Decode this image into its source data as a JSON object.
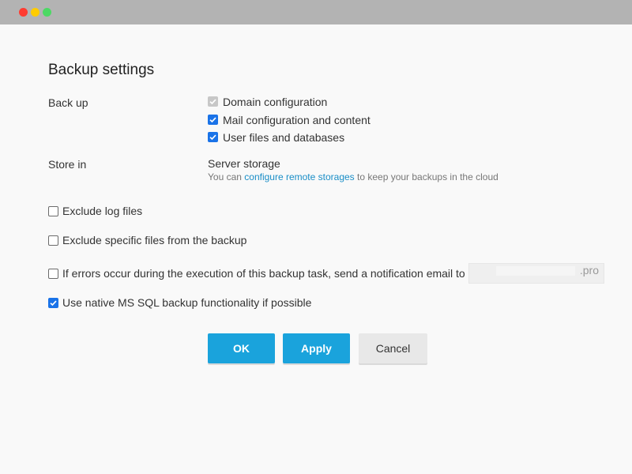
{
  "window": {
    "title_bar_colors": {
      "close": "#ff3b30",
      "minimize": "#ffcc00",
      "maximize": "#4cd964"
    }
  },
  "page": {
    "title": "Backup settings"
  },
  "backup": {
    "label": "Back up",
    "options": [
      {
        "label": "Domain configuration",
        "checked": true,
        "disabled": true
      },
      {
        "label": "Mail configuration and content",
        "checked": true,
        "disabled": false
      },
      {
        "label": "User files and databases",
        "checked": true,
        "disabled": false
      }
    ]
  },
  "store": {
    "label": "Store in",
    "value": "Server storage",
    "hint_prefix": "You can ",
    "hint_link": "configure remote storages",
    "hint_suffix": " to keep your backups in the cloud"
  },
  "options": {
    "exclude_logs": {
      "label": "Exclude log files",
      "checked": false
    },
    "exclude_files": {
      "label": "Exclude specific files from the backup",
      "checked": false
    },
    "notify_errors": {
      "label": "If errors occur during the execution of this backup task, send a notification email to",
      "checked": false
    },
    "email_value": ".pro",
    "native_mssql": {
      "label": "Use native MS SQL backup functionality if possible",
      "checked": true
    }
  },
  "buttons": {
    "ok": "OK",
    "apply": "Apply",
    "cancel": "Cancel"
  },
  "colors": {
    "accent": "#1aa3dc",
    "checkbox": "#1a73e8",
    "link": "#1a8ec7"
  }
}
